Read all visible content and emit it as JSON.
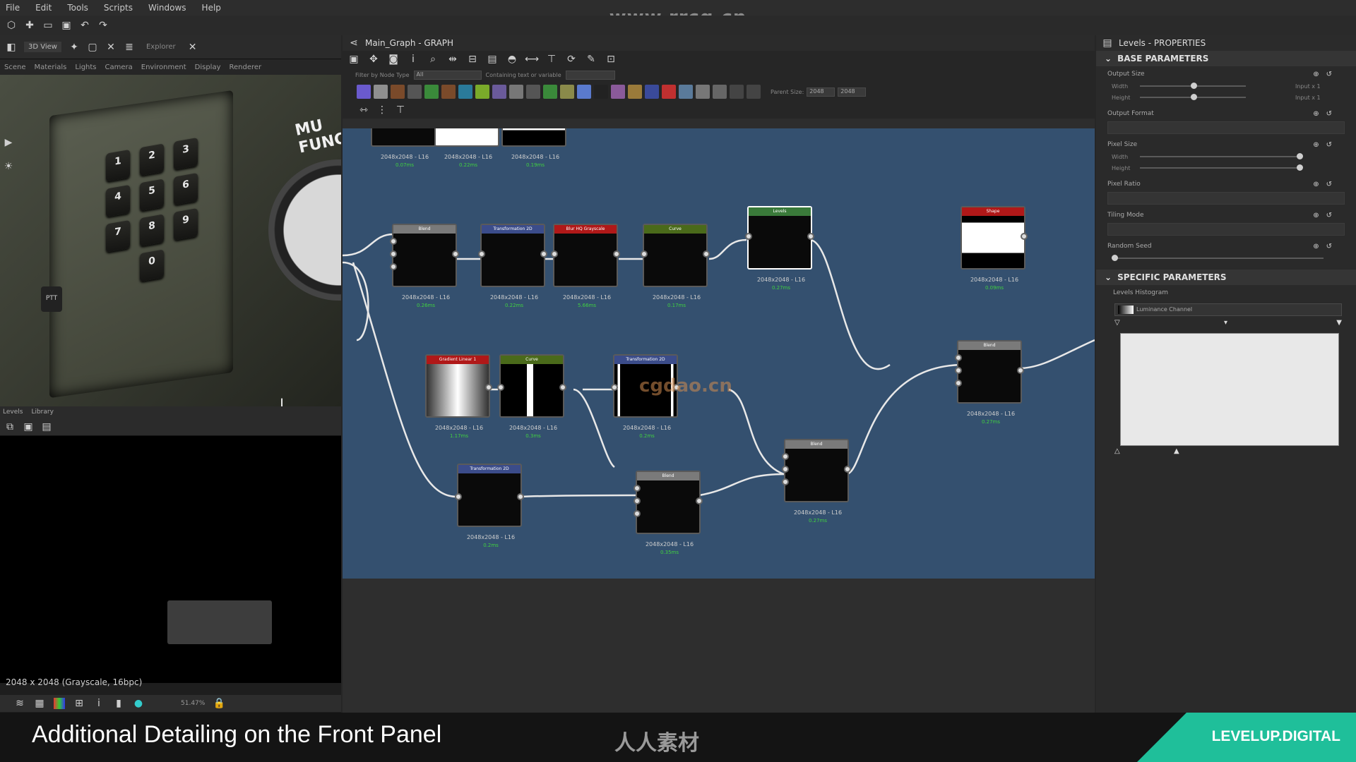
{
  "watermark": "www.rrcg.cn",
  "menubar": [
    "File",
    "Edit",
    "Tools",
    "Scripts",
    "Windows",
    "Help"
  ],
  "view3d": {
    "tab_3d": "3D View",
    "tab_explorer": "Explorer",
    "menu": [
      "Scene",
      "Materials",
      "Lights",
      "Camera",
      "Environment",
      "Display",
      "Renderer"
    ],
    "keys": [
      "1",
      "2",
      "3",
      "4",
      "5",
      "6",
      "7",
      "8",
      "9",
      "0"
    ],
    "label_mu": "MU\nFUNC",
    "ptt": "PTT"
  },
  "levels_tabs": [
    "Levels",
    "Library"
  ],
  "preview": {
    "status": "2048 x 2048 (Grayscale, 16bpc)",
    "zoom": "51.47%"
  },
  "graph": {
    "title": "Main_Graph - GRAPH",
    "filter_label": "Filter by Node Type",
    "filter_value": "All",
    "containing_label": "Containing text or variable",
    "parent_size_label": "Parent Size:",
    "size_w": "2048",
    "size_h": "2048",
    "nodes": [
      {
        "hdr": "",
        "meta": "2048x2048 - L16",
        "time": "0.07ms",
        "color": "#0a0a0a"
      },
      {
        "hdr": "",
        "meta": "2048x2048 - L16",
        "time": "0.22ms",
        "color": "#0a0a0a"
      },
      {
        "hdr": "",
        "meta": "2048x2048 - L16",
        "time": "0.19ms",
        "color": "#0a0a0a"
      },
      {
        "hdr": "Blend",
        "meta": "2048x2048 - L16",
        "time": "0.26ms",
        "color": "#7a7a7a"
      },
      {
        "hdr": "Transformation 2D",
        "meta": "2048x2048 - L16",
        "time": "0.22ms",
        "color": "#3b4c8a"
      },
      {
        "hdr": "Blur HQ Grayscale",
        "meta": "2048x2048 - L16",
        "time": "5.66ms",
        "color": "#b01818"
      },
      {
        "hdr": "Curve",
        "meta": "2048x2048 - L16",
        "time": "0.17ms",
        "color": "#4a6a1a"
      },
      {
        "hdr": "Levels",
        "meta": "2048x2048 - L16",
        "time": "0.27ms",
        "color": "#3a7a3a"
      },
      {
        "hdr": "Shape",
        "meta": "2048x2048 - L16",
        "time": "0.09ms",
        "color": "#b01818"
      },
      {
        "hdr": "Gradient Linear 1",
        "meta": "2048x2048 - L16",
        "time": "1.17ms",
        "color": "#b01818"
      },
      {
        "hdr": "Curve",
        "meta": "2048x2048 - L16",
        "time": "0.3ms",
        "color": "#4a6a1a"
      },
      {
        "hdr": "Transformation 2D",
        "meta": "2048x2048 - L16",
        "time": "0.2ms",
        "color": "#3b4c8a"
      },
      {
        "hdr": "Blend",
        "meta": "2048x2048 - L16",
        "time": "0.27ms",
        "color": "#7a7a7a"
      },
      {
        "hdr": "Blend",
        "meta": "2048x2048 - L16",
        "time": "0.27ms",
        "color": "#7a7a7a"
      },
      {
        "hdr": "Transformation 2D",
        "meta": "2048x2048 - L16",
        "time": "0.2ms",
        "color": "#3b4c8a"
      },
      {
        "hdr": "Blend",
        "meta": "2048x2048 - L16",
        "time": "0.35ms",
        "color": "#7a7a7a"
      }
    ],
    "watermark_center": "cgdao.cn"
  },
  "properties": {
    "title": "Levels - PROPERTIES",
    "base_section": "BASE PARAMETERS",
    "output_size": "Output Size",
    "width": "Width",
    "height": "Height",
    "input_x1": "Input x 1",
    "output_format": "Output Format",
    "pixel_size": "Pixel Size",
    "pixel_ratio": "Pixel Ratio",
    "tiling_mode": "Tiling Mode",
    "random_seed": "Random Seed",
    "specific_section": "SPECIFIC PARAMETERS",
    "levels_histogram": "Levels Histogram",
    "luminance_channel": "Luminance Channel"
  },
  "caption": {
    "text": "Additional Detailing on the Front Panel",
    "logo": "人人素材",
    "brand": "LEVELUP.DIGITAL"
  }
}
